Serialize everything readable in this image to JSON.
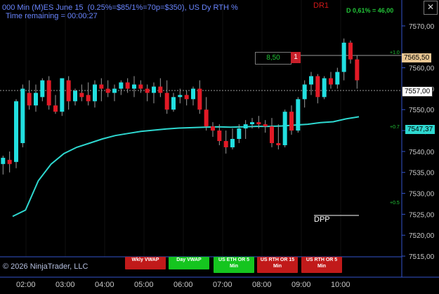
{
  "header": {
    "line1": "000 Min (M)ES June 15  (0.25%=$85/1%=70p=$350), US Dy RTH %",
    "line2": "Time remaining = 00:00:27",
    "dr_label": "DR1",
    "daily_stat": "D 0,61% = 46,00",
    "close_glyph": "✕"
  },
  "price_axis": {
    "labels": [
      "7570,00",
      "7560,00",
      "7555,00",
      "7550,00",
      "7545,00",
      "7540,00",
      "7535,00",
      "7530,00",
      "7525,00",
      "7520,00",
      "7515,00"
    ],
    "tags": {
      "high_line": "7565,50",
      "last_price": "7557,00",
      "vwap": "7547,37"
    },
    "percent_marks": [
      "+1.0",
      "+0.7",
      "+0.5"
    ]
  },
  "time_axis": [
    "02:00",
    "03:00",
    "04:00",
    "05:00",
    "06:00",
    "07:00",
    "08:00",
    "09:00",
    "10:00"
  ],
  "order_box": {
    "value": "8,50",
    "count": "1"
  },
  "dpp_label": "DPP",
  "copyright": "© 2026 NinjaTrader, LLC",
  "buttons": [
    {
      "line1": "Wkly VWAP",
      "line2": "",
      "color": "red"
    },
    {
      "line1": "Day VWAP",
      "line2": "",
      "color": "green"
    },
    {
      "line1": "US ETH OR 5",
      "line2": "Min",
      "color": "green"
    },
    {
      "line1": "US RTH OR 15",
      "line2": "Min",
      "color": "red"
    },
    {
      "line1": "US RTH OR 5",
      "line2": "Min",
      "color": "red"
    }
  ],
  "colors": {
    "up": "#22dfe0",
    "down": "#e21a26",
    "vwap": "#2ed8d0",
    "axis": "#3355cc",
    "grid": "#111"
  },
  "chart_data": {
    "type": "candlestick",
    "ylim": [
      7514,
      7576
    ],
    "candles": [
      {
        "t": "01:25",
        "o": 7537.0,
        "h": 7539.0,
        "l": 7534.5,
        "c": 7538.5
      },
      {
        "t": "01:35",
        "o": 7538.0,
        "h": 7540.0,
        "l": 7535.0,
        "c": 7537.0
      },
      {
        "t": "01:45",
        "o": 7537.5,
        "h": 7552.5,
        "l": 7536.0,
        "c": 7552.0
      },
      {
        "t": "01:55",
        "o": 7542.0,
        "h": 7556.0,
        "l": 7541.0,
        "c": 7555.0
      },
      {
        "t": "02:05",
        "o": 7554.0,
        "h": 7557.0,
        "l": 7550.0,
        "c": 7551.0
      },
      {
        "t": "02:15",
        "o": 7551.0,
        "h": 7556.0,
        "l": 7549.5,
        "c": 7554.0
      },
      {
        "t": "02:25",
        "o": 7553.0,
        "h": 7557.5,
        "l": 7552.0,
        "c": 7557.0
      },
      {
        "t": "02:35",
        "o": 7557.0,
        "h": 7558.0,
        "l": 7550.0,
        "c": 7551.0
      },
      {
        "t": "02:45",
        "o": 7551.0,
        "h": 7553.5,
        "l": 7549.0,
        "c": 7549.5
      },
      {
        "t": "02:55",
        "o": 7549.5,
        "h": 7557.5,
        "l": 7548.5,
        "c": 7557.5
      },
      {
        "t": "03:05",
        "o": 7557.0,
        "h": 7558.0,
        "l": 7550.0,
        "c": 7552.0
      },
      {
        "t": "03:15",
        "o": 7552.0,
        "h": 7555.0,
        "l": 7551.0,
        "c": 7554.5
      },
      {
        "t": "03:25",
        "o": 7554.0,
        "h": 7556.0,
        "l": 7552.0,
        "c": 7553.0
      },
      {
        "t": "03:35",
        "o": 7553.5,
        "h": 7556.5,
        "l": 7551.0,
        "c": 7552.0
      },
      {
        "t": "03:45",
        "o": 7552.0,
        "h": 7557.0,
        "l": 7550.5,
        "c": 7556.0
      },
      {
        "t": "03:55",
        "o": 7556.0,
        "h": 7557.5,
        "l": 7552.0,
        "c": 7555.0
      },
      {
        "t": "04:05",
        "o": 7555.0,
        "h": 7557.0,
        "l": 7553.0,
        "c": 7554.0
      },
      {
        "t": "04:15",
        "o": 7554.0,
        "h": 7556.0,
        "l": 7552.0,
        "c": 7555.0
      },
      {
        "t": "04:25",
        "o": 7555.0,
        "h": 7557.0,
        "l": 7553.5,
        "c": 7556.5
      },
      {
        "t": "04:35",
        "o": 7556.5,
        "h": 7557.5,
        "l": 7554.0,
        "c": 7555.0
      },
      {
        "t": "04:45",
        "o": 7555.0,
        "h": 7558.0,
        "l": 7553.0,
        "c": 7556.0
      },
      {
        "t": "04:55",
        "o": 7556.0,
        "h": 7557.0,
        "l": 7554.0,
        "c": 7555.0
      },
      {
        "t": "05:05",
        "o": 7555.0,
        "h": 7556.0,
        "l": 7552.0,
        "c": 7554.0
      },
      {
        "t": "05:15",
        "o": 7554.0,
        "h": 7556.5,
        "l": 7551.5,
        "c": 7555.5
      },
      {
        "t": "05:25",
        "o": 7555.5,
        "h": 7557.5,
        "l": 7553.0,
        "c": 7554.0
      },
      {
        "t": "05:35",
        "o": 7554.0,
        "h": 7557.0,
        "l": 7549.0,
        "c": 7550.0
      },
      {
        "t": "05:45",
        "o": 7550.0,
        "h": 7554.0,
        "l": 7549.5,
        "c": 7553.0
      },
      {
        "t": "05:55",
        "o": 7553.0,
        "h": 7555.0,
        "l": 7551.5,
        "c": 7553.5
      },
      {
        "t": "06:05",
        "o": 7553.5,
        "h": 7554.5,
        "l": 7551.0,
        "c": 7552.5
      },
      {
        "t": "06:15",
        "o": 7552.5,
        "h": 7555.5,
        "l": 7551.0,
        "c": 7555.0
      },
      {
        "t": "06:25",
        "o": 7555.0,
        "h": 7557.0,
        "l": 7549.0,
        "c": 7550.0
      },
      {
        "t": "06:35",
        "o": 7550.0,
        "h": 7553.0,
        "l": 7545.0,
        "c": 7546.0
      },
      {
        "t": "06:45",
        "o": 7546.0,
        "h": 7547.0,
        "l": 7543.5,
        "c": 7545.0
      },
      {
        "t": "06:55",
        "o": 7545.0,
        "h": 7546.5,
        "l": 7541.5,
        "c": 7542.5
      },
      {
        "t": "07:05",
        "o": 7542.5,
        "h": 7545.0,
        "l": 7539.5,
        "c": 7541.0
      },
      {
        "t": "07:15",
        "o": 7541.0,
        "h": 7545.5,
        "l": 7540.5,
        "c": 7543.0
      },
      {
        "t": "07:25",
        "o": 7543.0,
        "h": 7546.5,
        "l": 7542.0,
        "c": 7545.5
      },
      {
        "t": "07:35",
        "o": 7545.5,
        "h": 7547.5,
        "l": 7543.0,
        "c": 7546.5
      },
      {
        "t": "07:45",
        "o": 7546.5,
        "h": 7548.0,
        "l": 7545.5,
        "c": 7547.0
      },
      {
        "t": "07:55",
        "o": 7547.0,
        "h": 7548.5,
        "l": 7545.5,
        "c": 7546.5
      },
      {
        "t": "08:05",
        "o": 7546.5,
        "h": 7547.5,
        "l": 7544.5,
        "c": 7546.0
      },
      {
        "t": "08:15",
        "o": 7546.0,
        "h": 7548.0,
        "l": 7541.0,
        "c": 7542.0
      },
      {
        "t": "08:25",
        "o": 7542.0,
        "h": 7546.5,
        "l": 7540.5,
        "c": 7541.5
      },
      {
        "t": "08:35",
        "o": 7541.5,
        "h": 7550.0,
        "l": 7541.0,
        "c": 7549.5
      },
      {
        "t": "08:45",
        "o": 7549.5,
        "h": 7551.0,
        "l": 7544.0,
        "c": 7545.0
      },
      {
        "t": "08:55",
        "o": 7545.0,
        "h": 7553.0,
        "l": 7544.5,
        "c": 7552.5
      },
      {
        "t": "09:05",
        "o": 7552.5,
        "h": 7557.0,
        "l": 7550.5,
        "c": 7556.0
      },
      {
        "t": "09:15",
        "o": 7556.0,
        "h": 7559.0,
        "l": 7553.5,
        "c": 7558.0
      },
      {
        "t": "09:25",
        "o": 7558.0,
        "h": 7558.5,
        "l": 7551.5,
        "c": 7553.0
      },
      {
        "t": "09:35",
        "o": 7553.0,
        "h": 7558.0,
        "l": 7552.5,
        "c": 7557.5
      },
      {
        "t": "09:45",
        "o": 7557.5,
        "h": 7559.0,
        "l": 7555.0,
        "c": 7556.0
      },
      {
        "t": "09:55",
        "o": 7556.0,
        "h": 7560.0,
        "l": 7555.0,
        "c": 7559.0
      },
      {
        "t": "10:05",
        "o": 7559.0,
        "h": 7567.0,
        "l": 7557.0,
        "c": 7566.0
      },
      {
        "t": "10:15",
        "o": 7566.0,
        "h": 7566.5,
        "l": 7561.0,
        "c": 7562.0
      },
      {
        "t": "10:25",
        "o": 7562.0,
        "h": 7563.0,
        "l": 7555.0,
        "c": 7557.0
      }
    ],
    "vwap": [
      [
        0,
        7524.5
      ],
      [
        2,
        7526.0
      ],
      [
        4,
        7533.0
      ],
      [
        6,
        7537.0
      ],
      [
        8,
        7539.5
      ],
      [
        10,
        7541.0
      ],
      [
        12,
        7542.0
      ],
      [
        14,
        7543.0
      ],
      [
        16,
        7543.8
      ],
      [
        18,
        7544.3
      ],
      [
        20,
        7544.8
      ],
      [
        22,
        7545.1
      ],
      [
        24,
        7545.4
      ],
      [
        26,
        7545.6
      ],
      [
        28,
        7545.7
      ],
      [
        30,
        7545.8
      ],
      [
        32,
        7545.9
      ],
      [
        34,
        7545.8
      ],
      [
        36,
        7545.9
      ],
      [
        38,
        7546.0
      ],
      [
        40,
        7546.0
      ],
      [
        42,
        7546.1
      ],
      [
        44,
        7546.3
      ],
      [
        46,
        7546.5
      ],
      [
        48,
        7546.9
      ],
      [
        50,
        7547.1
      ],
      [
        52,
        7547.8
      ],
      [
        54,
        7548.3
      ]
    ]
  }
}
